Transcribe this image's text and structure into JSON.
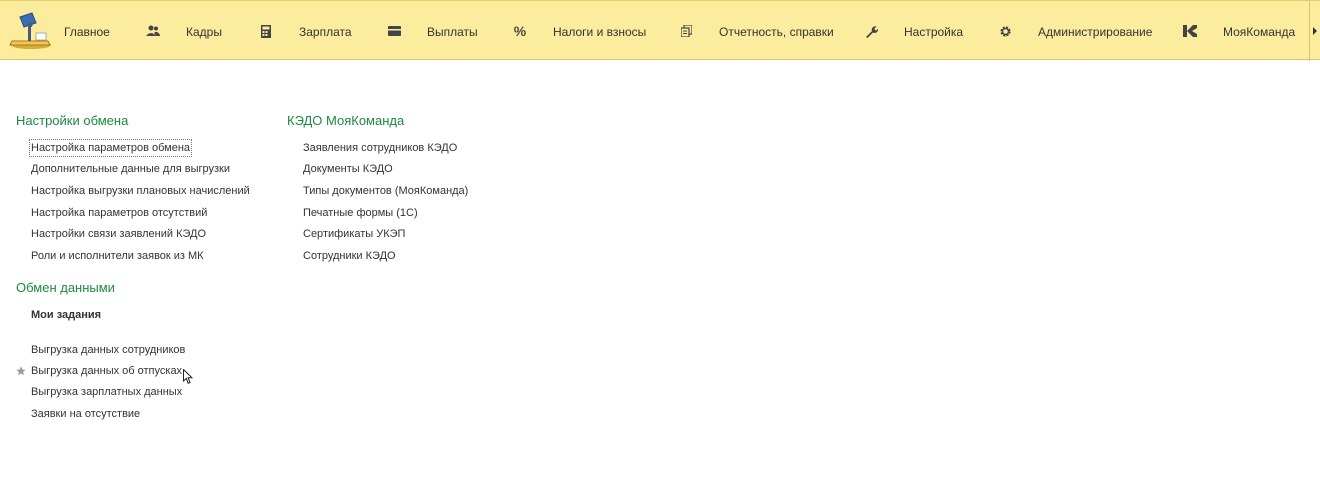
{
  "nav": {
    "items": [
      {
        "label": "Главное",
        "icon": "lamp-logo-icon"
      },
      {
        "label": "Кадры",
        "icon": "people-icon"
      },
      {
        "label": "Зарплата",
        "icon": "calculator-icon"
      },
      {
        "label": "Выплаты",
        "icon": "wallet-icon"
      },
      {
        "label": "Налоги и взносы",
        "icon": "percent-icon"
      },
      {
        "label": "Отчетность, справки",
        "icon": "documents-icon"
      },
      {
        "label": "Настройка",
        "icon": "wrench-icon"
      },
      {
        "label": "Администрирование",
        "icon": "gear-icon"
      },
      {
        "label": "МояКоманда",
        "icon": "moyakomanda-icon"
      }
    ],
    "percent_glyph": "%"
  },
  "exchange_settings": {
    "title": "Настройки обмена",
    "items": [
      "Настройка параметров обмена",
      "Дополнительные данные для выгрузки",
      "Настройка выгрузки плановых начислений",
      "Настройка параметров отсутствий",
      "Настройки связи заявлений КЭДО",
      "Роли и исполнители заявок из МК"
    ]
  },
  "data_exchange": {
    "title": "Обмен данными",
    "my_tasks": "Мои задания",
    "items": [
      "Выгрузка данных сотрудников",
      "Выгрузка данных об отпусках",
      "Выгрузка зарплатных данных",
      "Заявки на отсутствие"
    ]
  },
  "kedo": {
    "title": "КЭДО МояКоманда",
    "items": [
      "Заявления сотрудников КЭДО",
      "Документы КЭДО",
      "Типы документов (МояКоманда)",
      "Печатные формы (1С)",
      "Сертификаты УКЭП",
      "Сотрудники КЭДО"
    ]
  },
  "colors": {
    "panel": "#fbec9e",
    "group_title": "#1b8a3f",
    "text": "#333333"
  }
}
